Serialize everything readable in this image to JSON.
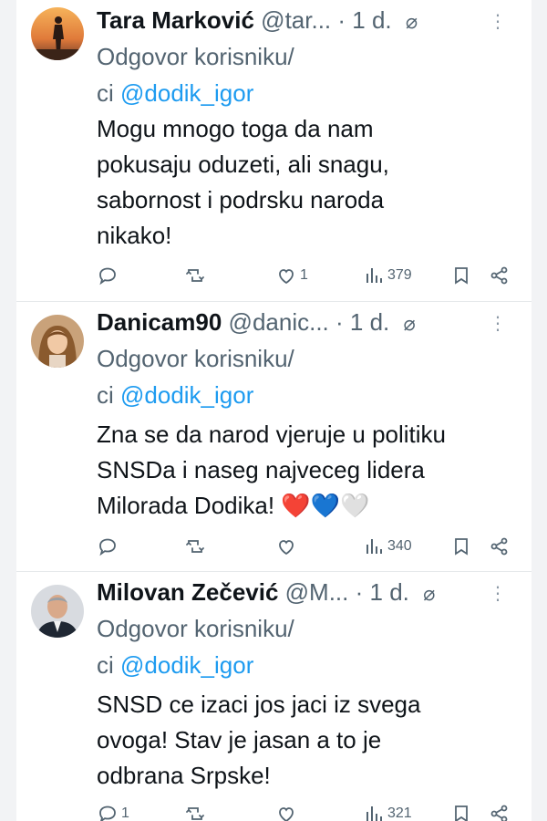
{
  "tweets": [
    {
      "name": "Tara Marković",
      "handle": "@tar...",
      "time": "· 1 d.",
      "reply_prefix": "Odgovor korisniku/",
      "reply_line2": "ci ",
      "mention": "@dodik_igor",
      "text_lines": [
        "Mogu mnogo toga da nam",
        "pokusaju oduzeti, ali snagu,",
        "sabornost i podrsku naroda",
        "nikako!"
      ],
      "likes": "1",
      "views": "379",
      "replies": ""
    },
    {
      "name": "Danicam90",
      "handle": "@danic...",
      "time": "· 1 d.",
      "reply_prefix": "Odgovor korisniku/",
      "reply_line2": "ci ",
      "mention": "@dodik_igor",
      "text_lines": [
        "Zna se da narod vjeruje u politiku",
        "SNSDa i naseg najveceg lidera",
        "Milorada Dodika! ❤️💙🤍"
      ],
      "likes": "",
      "views": "340",
      "replies": ""
    },
    {
      "name": "Milovan Zečević",
      "handle": "@M...",
      "time": "· 1 d.",
      "reply_prefix": "Odgovor korisniku/",
      "reply_line2": "ci ",
      "mention": "@dodik_igor",
      "text_lines": [
        "SNSD ce izaci jos jaci iz svega",
        "ovoga! Stav je jasan a to je",
        "odbrana Srpske!"
      ],
      "likes": "",
      "views": "321",
      "replies": "1"
    }
  ],
  "colors": {
    "accent": "#1d9bf0",
    "muted": "#536471",
    "text": "#0f1419",
    "heart_red": "#e0245e"
  },
  "icons": [
    "reply-icon",
    "retweet-icon",
    "like-icon",
    "views-icon",
    "bookmark-icon",
    "share-icon",
    "verified-icon",
    "more-icon"
  ]
}
